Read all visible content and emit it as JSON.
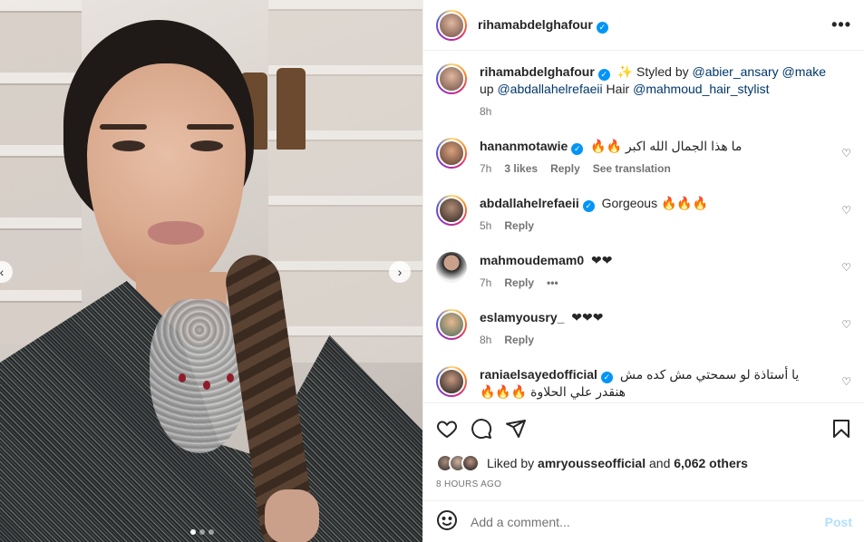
{
  "post": {
    "author": "rihamabdelghafour",
    "caption_icon": "✨",
    "caption_parts": {
      "styled_by": "Styled by",
      "stylist": "@abier_ansary",
      "makeup_handle": "@make",
      "makeup_word": "up",
      "makeup_artist": "@abdallahelrefaeii",
      "hair_word": "Hair",
      "hair_stylist": "@mahmoud_hair_stylist"
    },
    "caption_time": "8h",
    "media_dots": 3,
    "active_dot": 0
  },
  "comments": [
    {
      "user": "hananmotawie",
      "verified": true,
      "text": "ما هذا الجمال الله اكبر 🔥🔥",
      "time": "7h",
      "likes": "3 likes",
      "reply": "Reply",
      "translate": "See translation"
    },
    {
      "user": "abdallahelrefaeii",
      "verified": true,
      "text": "Gorgeous 🔥🔥🔥",
      "time": "5h",
      "reply": "Reply"
    },
    {
      "user": "mahmoudemam0",
      "verified": false,
      "text": "❤❤",
      "time": "7h",
      "reply": "Reply",
      "more": "•••"
    },
    {
      "user": "eslamyousry_",
      "verified": false,
      "text": "❤❤❤",
      "time": "8h",
      "reply": "Reply"
    },
    {
      "user": "raniaelsayedofficial",
      "verified": true,
      "text": "يا أستاذة لو سمحتي مش كده مش هنقدر علي الحلاوة 🔥🔥🔥",
      "time": "",
      "reply": ""
    }
  ],
  "likes": {
    "liked_by": "Liked by",
    "user": "amryousseofficial",
    "and": "and",
    "others": "6,062 others"
  },
  "time_ago": "8 HOURS AGO",
  "add_comment": {
    "placeholder": "Add a comment...",
    "post_label": "Post"
  },
  "colors": {
    "verified": "#0095f6",
    "mention": "#00376b",
    "post_disabled": "#b2dffc"
  }
}
